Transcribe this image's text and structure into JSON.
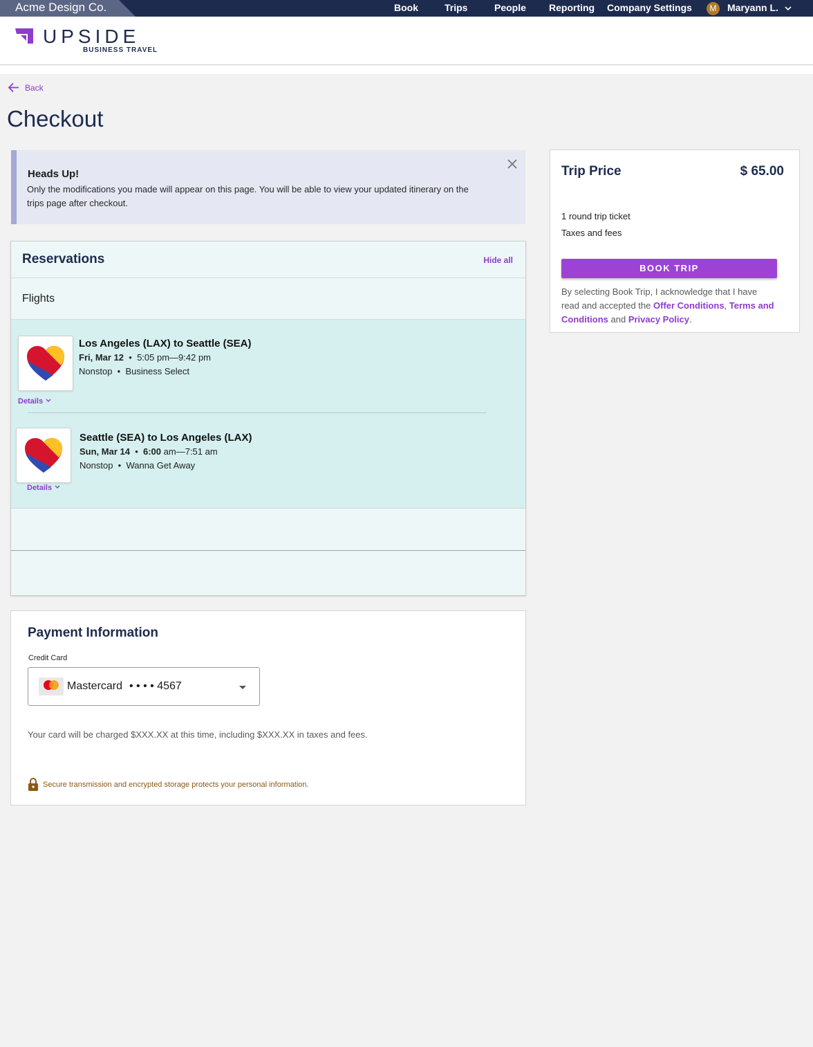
{
  "topbar": {
    "company": "Acme Design Co.",
    "nav": [
      "Book",
      "Trips",
      "People",
      "Reporting",
      "Company Settings"
    ],
    "user_initial": "M",
    "user_name": "Maryann L."
  },
  "brand": {
    "name": "UPSIDE",
    "subtitle": "BUSINESS TRAVEL",
    "color": "#8e3bd0"
  },
  "back_label": "Back",
  "page_title": "Checkout",
  "alert": {
    "title": "Heads Up!",
    "body": "Only the modifications you made will appear on this page. You will be able to view your updated itinerary on the trips page after checkout."
  },
  "reservations": {
    "title": "Reservations",
    "hide_all": "Hide all",
    "section_label": "Flights",
    "flights": [
      {
        "route": "Los Angeles (LAX) to Seattle (SEA)",
        "date": "Fri, Mar 12",
        "time": "5:05 pm—9:42 pm",
        "stops": "Nonstop",
        "fare": "Business Select",
        "details": "Details"
      },
      {
        "route": "Seattle (SEA) to Los Angeles (LAX)",
        "date": "Sun, Mar 14",
        "time_start": "6:00",
        "time_rest": " am—7:51 am",
        "stops": "Nonstop",
        "fare": "Wanna Get Away",
        "details": "Details"
      }
    ]
  },
  "trip_price": {
    "title": "Trip Price",
    "amount": "$ 65.00",
    "lines": [
      "1 round trip ticket",
      "Taxes and fees"
    ],
    "button": "BOOK TRIP",
    "ack_prefix": "By selecting Book Trip, I acknowledge that I have read and accepted the ",
    "offer_conditions": "Offer Conditions",
    "comma": ",",
    "terms": "Terms and Conditions",
    "and": " and ",
    "privacy": "Privacy Policy",
    "period": "."
  },
  "payment": {
    "title": "Payment Information",
    "cc_label": "Credit Card",
    "card_brand": "Mastercard",
    "card_number": "• • • • 4567",
    "charge_text": "Your card will be charged $XXX.XX at this time, including $XXX.XX in taxes and fees.",
    "secure_text": "Secure transmission and encrypted storage protects your personal information."
  },
  "colors": {
    "navy": "#1d2b4f",
    "accent": "#9c43d6",
    "teal": "#d5f0ef"
  }
}
